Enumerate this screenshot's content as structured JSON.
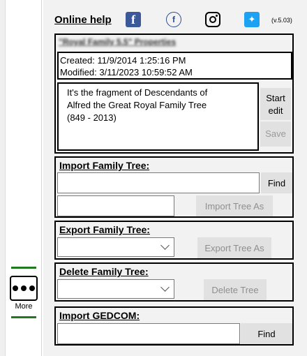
{
  "sidebar": {
    "more_label": "More"
  },
  "header": {
    "online_help": "Online help",
    "icons": [
      "facebook-icon",
      "familysearch-icon",
      "instagram-icon",
      "twitter-icon"
    ],
    "version": "(v.5.03)"
  },
  "project": {
    "title": "\"Royal Family 5.5\" Properties",
    "created": "Created: 11/9/2014 1:25:16 PM",
    "modified": "Modified: 3/11/2023 10:59:52 AM",
    "description_lines": [
      "It's the fragment of Descendants of",
      "Alfred the Great Royal Family Tree",
      "(849 - 2013)"
    ],
    "start_edit_lines": [
      "Start",
      "edit"
    ],
    "save_label": "Save"
  },
  "import_tree": {
    "title": "Import Family Tree:",
    "find_label": "Find",
    "import_as_label": "Import Tree As"
  },
  "export_tree": {
    "title": "Export Family Tree:",
    "export_as_label": "Export Tree As"
  },
  "delete_tree": {
    "title": "Delete Family Tree:",
    "delete_label": "Delete Tree"
  },
  "import_gedcom": {
    "title": "Import GEDCOM:",
    "find_label": "Find"
  },
  "colors": {
    "panel_bg": "#f2f2f2",
    "button_bg": "#e1e1e1",
    "disabled_text": "#8f8f8f",
    "more_accent": "#1f7a1f",
    "facebook": "#3b5998",
    "twitter": "#1da1f2"
  }
}
